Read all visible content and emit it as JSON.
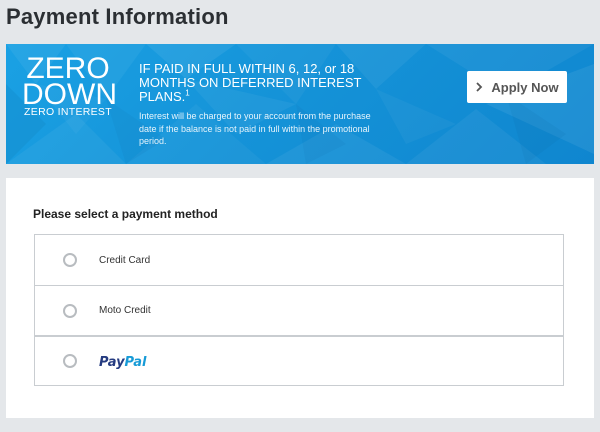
{
  "page": {
    "title": "Payment Information"
  },
  "promo": {
    "badge_line1": "ZERO",
    "badge_line2": "DOWN",
    "badge_sub": "ZERO INTEREST",
    "headline": "IF PAID IN FULL WITHIN 6, 12, or 18 MONTHS ON DEFERRED INTEREST PLANS.",
    "footnote_mark": "1",
    "fine_print": "Interest will be charged to your account from the purchase date if the balance is not paid in full within the promotional period.",
    "apply_label": "Apply Now",
    "colors": {
      "banner": "#1598db",
      "button_bg": "#ffffff"
    }
  },
  "payment": {
    "section_title": "Please select a payment method",
    "options": [
      {
        "label": "Credit Card",
        "selected": false
      },
      {
        "label": "Moto Credit",
        "selected": false
      },
      {
        "label": "PayPal",
        "selected": false,
        "is_logo": true
      }
    ],
    "colors": {
      "paypal_dark": "#253b80",
      "paypal_light": "#179bd7"
    }
  }
}
